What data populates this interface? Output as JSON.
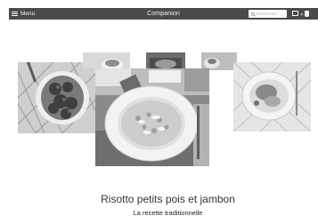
{
  "header": {
    "menu_label": "Menu",
    "title": "Companion",
    "search_placeholder": "Rechercher"
  },
  "recipe": {
    "title": "Risotto petits pois et jambon",
    "subtitle": "La recette traditionnelle"
  },
  "icons": {
    "menu": "hamburger-icon",
    "search": "search-icon",
    "screen": "screen-icon",
    "plug": "plug-icon"
  }
}
